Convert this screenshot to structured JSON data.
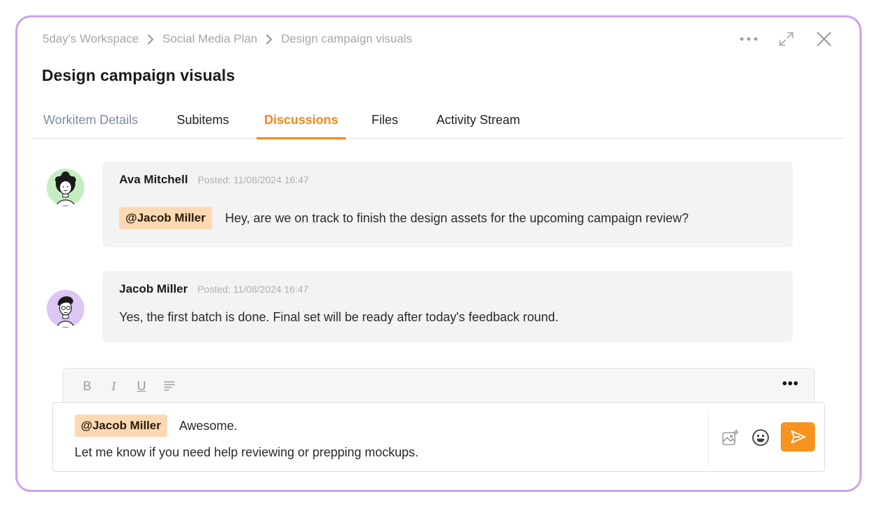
{
  "breadcrumb": [
    "5day's Workspace",
    "Social Media Plan",
    "Design campaign visuals"
  ],
  "title": "Design campaign visuals",
  "tabs": [
    {
      "label": "Workitem Details",
      "state": "muted"
    },
    {
      "label": "Subitems",
      "state": "normal"
    },
    {
      "label": "Discussions",
      "state": "active"
    },
    {
      "label": "Files",
      "state": "normal"
    },
    {
      "label": "Activity Stream",
      "state": "normal"
    }
  ],
  "messages": [
    {
      "author": "Ava Mitchell",
      "posted": "Posted: 11/08/2024 16:47",
      "mention": "@Jacob Miller",
      "text": "Hey, are we on track to finish the design assets for the upcoming campaign review?"
    },
    {
      "author": "Jacob Miller",
      "posted": "Posted: 11/08/2024 16:47",
      "text": "Yes, the first batch is done. Final set will be ready after today's feedback round."
    }
  ],
  "toolbar": {
    "bold": "B",
    "italic": "I",
    "underline": "U",
    "more": "•••"
  },
  "composer": {
    "mention": "@Jacob Miller",
    "line1": "Awesome.",
    "line2": "Let me know if you need help reviewing or prepping mockups."
  },
  "icons": {
    "window": [
      "more-horizontal-icon",
      "expand-icon",
      "close-icon"
    ],
    "toolbar": [
      "bold-icon",
      "italic-icon",
      "underline-icon",
      "align-left-icon",
      "more-icon"
    ],
    "composer": [
      "add-image-icon",
      "emoji-icon",
      "send-icon"
    ]
  },
  "colors": {
    "accent": "#f08a18",
    "frame": "#c9a3ec",
    "mention_bg": "#fdd9b3",
    "bubble_bg": "#f3f3f3"
  }
}
